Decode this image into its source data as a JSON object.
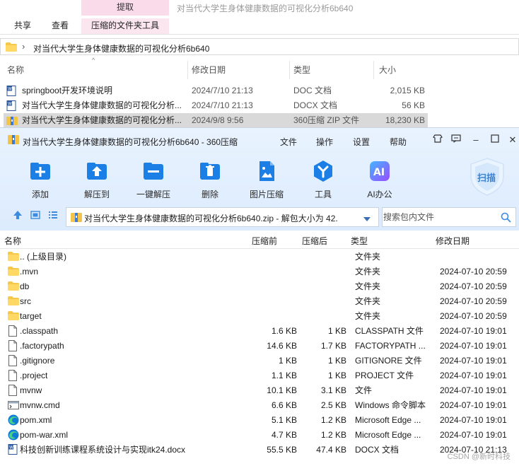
{
  "explorer": {
    "context_tab_header": "提取",
    "context_title": "对当代大学生身体健康数据的可视化分析6b640",
    "tabs": [
      "共享",
      "查看",
      "压缩的文件夹工具"
    ],
    "address": "对当代大学生身体健康数据的可视化分析6b640",
    "columns": {
      "name": "名称",
      "date": "修改日期",
      "type": "类型",
      "size": "大小"
    },
    "files": [
      {
        "name": "springboot开发环境说明",
        "date": "2024/7/10 21:13",
        "type": "DOC 文档",
        "size": "2,015 KB",
        "icon": "word-doc-icon",
        "selected": false
      },
      {
        "name": "对当代大学生身体健康数据的可视化分析...",
        "date": "2024/7/10 21:13",
        "type": "DOCX 文档",
        "size": "56 KB",
        "icon": "word-docx-icon",
        "selected": false
      },
      {
        "name": "对当代大学生身体健康数据的可视化分析...",
        "date": "2024/9/8 9:56",
        "type": "360压缩 ZIP 文件",
        "size": "18,230 KB",
        "icon": "zip-archive-icon",
        "selected": true
      }
    ]
  },
  "zip": {
    "title": "对当代大学生身体健康数据的可视化分析6b640 - 360压缩",
    "menu": [
      "文件",
      "操作",
      "设置",
      "帮助"
    ],
    "tools": [
      {
        "label": "添加",
        "icon": "add-icon"
      },
      {
        "label": "解压到",
        "icon": "extract-to-icon"
      },
      {
        "label": "一键解压",
        "icon": "one-click-extract-icon"
      },
      {
        "label": "删除",
        "icon": "delete-icon"
      },
      {
        "label": "图片压缩",
        "icon": "image-compress-icon"
      },
      {
        "label": "工具",
        "icon": "tools-icon"
      },
      {
        "label": "AI办公",
        "icon": "ai-office-icon"
      }
    ],
    "scan_label": "扫描",
    "path": "对当代大学生身体健康数据的可视化分析6b640.zip - 解包大小为 42.",
    "search_placeholder": "搜索包内文件",
    "columns": {
      "name": "名称",
      "compressed": "压缩前",
      "packed": "压缩后",
      "type": "类型",
      "date": "修改日期"
    },
    "entries": [
      {
        "name": ".. (上级目录)",
        "before": "",
        "after": "",
        "type": "文件夹",
        "date": "",
        "icon": "folder-icon"
      },
      {
        "name": ".mvn",
        "before": "",
        "after": "",
        "type": "文件夹",
        "date": "2024-07-10 20:59",
        "icon": "folder-icon"
      },
      {
        "name": "db",
        "before": "",
        "after": "",
        "type": "文件夹",
        "date": "2024-07-10 20:59",
        "icon": "folder-icon"
      },
      {
        "name": "src",
        "before": "",
        "after": "",
        "type": "文件夹",
        "date": "2024-07-10 20:59",
        "icon": "folder-icon"
      },
      {
        "name": "target",
        "before": "",
        "after": "",
        "type": "文件夹",
        "date": "2024-07-10 20:59",
        "icon": "folder-icon"
      },
      {
        "name": ".classpath",
        "before": "1.6 KB",
        "after": "1 KB",
        "type": "CLASSPATH 文件",
        "date": "2024-07-10 19:01",
        "icon": "file-icon"
      },
      {
        "name": ".factorypath",
        "before": "14.6 KB",
        "after": "1.7 KB",
        "type": "FACTORYPATH ...",
        "date": "2024-07-10 19:01",
        "icon": "file-icon"
      },
      {
        "name": ".gitignore",
        "before": "1 KB",
        "after": "1 KB",
        "type": "GITIGNORE 文件",
        "date": "2024-07-10 19:01",
        "icon": "file-icon"
      },
      {
        "name": ".project",
        "before": "1.1 KB",
        "after": "1 KB",
        "type": "PROJECT 文件",
        "date": "2024-07-10 19:01",
        "icon": "file-icon"
      },
      {
        "name": "mvnw",
        "before": "10.1 KB",
        "after": "3.1 KB",
        "type": "文件",
        "date": "2024-07-10 19:01",
        "icon": "file-icon"
      },
      {
        "name": "mvnw.cmd",
        "before": "6.6 KB",
        "after": "2.5 KB",
        "type": "Windows 命令脚本",
        "date": "2024-07-10 19:01",
        "icon": "cmd-script-icon"
      },
      {
        "name": "pom.xml",
        "before": "5.1 KB",
        "after": "1.2 KB",
        "type": "Microsoft Edge ...",
        "date": "2024-07-10 19:01",
        "icon": "edge-icon"
      },
      {
        "name": "pom-war.xml",
        "before": "4.7 KB",
        "after": "1.2 KB",
        "type": "Microsoft Edge ...",
        "date": "2024-07-10 19:01",
        "icon": "edge-icon"
      },
      {
        "name": "科技创新训练课程系统设计与实现itk24.docx",
        "before": "55.5 KB",
        "after": "47.4 KB",
        "type": "DOCX 文档",
        "date": "2024-07-10 21:13",
        "icon": "word-docx-icon"
      }
    ]
  },
  "watermark": "CSDN @新时科技"
}
